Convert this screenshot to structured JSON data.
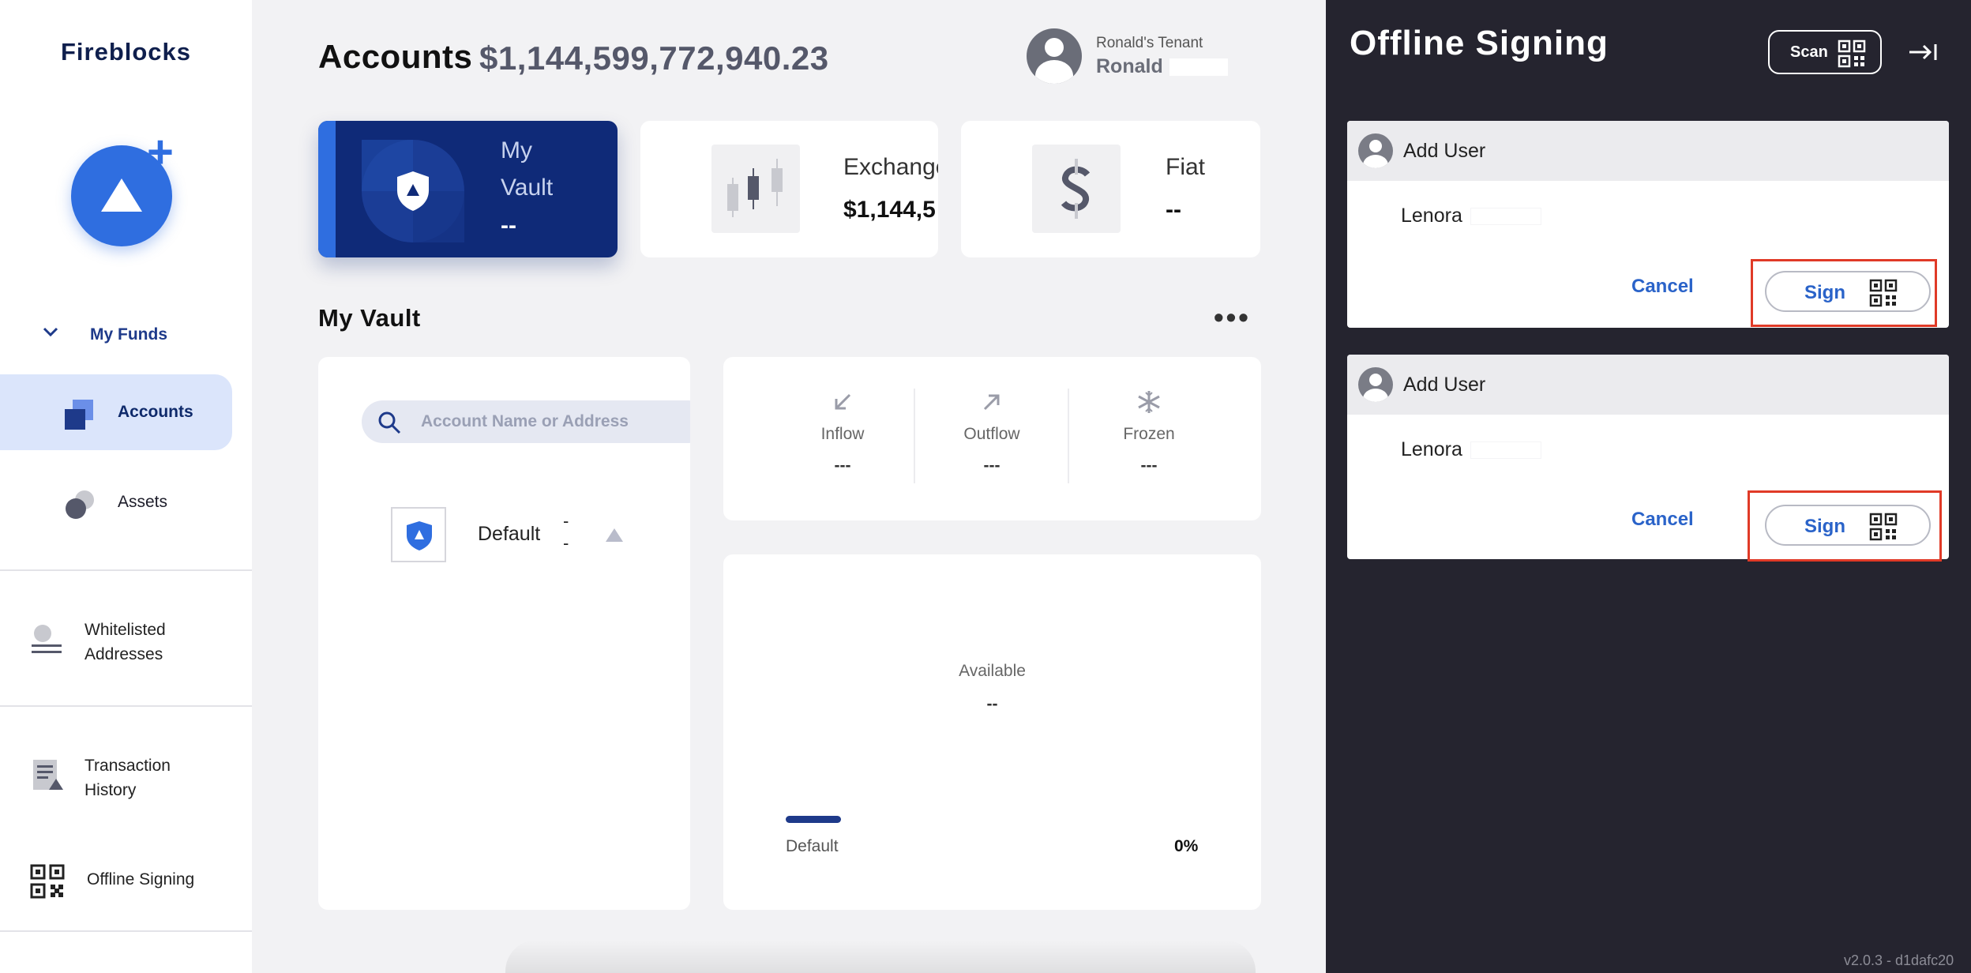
{
  "sidebar": {
    "brand": "Fireblocks",
    "section_label": "My Funds",
    "items": [
      {
        "label": "Accounts",
        "icon": "accounts-icon"
      },
      {
        "label": "Assets",
        "icon": "assets-icon"
      },
      {
        "label": "Whitelisted\nAddresses",
        "icon": "whitelist-icon"
      },
      {
        "label": "Transaction\nHistory",
        "icon": "history-icon"
      },
      {
        "label": "Offline Signing",
        "icon": "qr-icon"
      }
    ]
  },
  "header": {
    "title": "Accounts",
    "total": "$1,144,599,772,940.23",
    "tenant": "Ronald's Tenant",
    "user": "Ronald"
  },
  "cards": [
    {
      "name": "My\nVault",
      "value": "--"
    },
    {
      "name": "Exchange",
      "value": "$1,144,5"
    },
    {
      "name": "Fiat",
      "value": "--"
    }
  ],
  "vault": {
    "section_title": "My Vault",
    "more": "•••",
    "search_placeholder": "Account Name or Address",
    "account": {
      "name": "Default",
      "line1": "-",
      "line2": "-"
    },
    "stats": [
      {
        "label": "Inflow",
        "value": "---"
      },
      {
        "label": "Outflow",
        "value": "---"
      },
      {
        "label": "Frozen",
        "value": "---"
      }
    ],
    "available_label": "Available",
    "available_value": "--",
    "legend_name": "Default",
    "legend_pct": "0%"
  },
  "drawer": {
    "title": "Offline Signing",
    "scan_label": "Scan",
    "requests": [
      {
        "title": "Add User",
        "user": "Lenora",
        "cancel": "Cancel",
        "sign": "Sign"
      },
      {
        "title": "Add User",
        "user": "Lenora",
        "cancel": "Cancel",
        "sign": "Sign"
      }
    ],
    "version": "v2.0.3 - d1dafc20"
  },
  "colors": {
    "accent": "#2f6ee0",
    "navy": "#0f2a78",
    "drawer_bg": "#25242f",
    "highlight": "#e03a27",
    "link": "#2a63c9"
  }
}
